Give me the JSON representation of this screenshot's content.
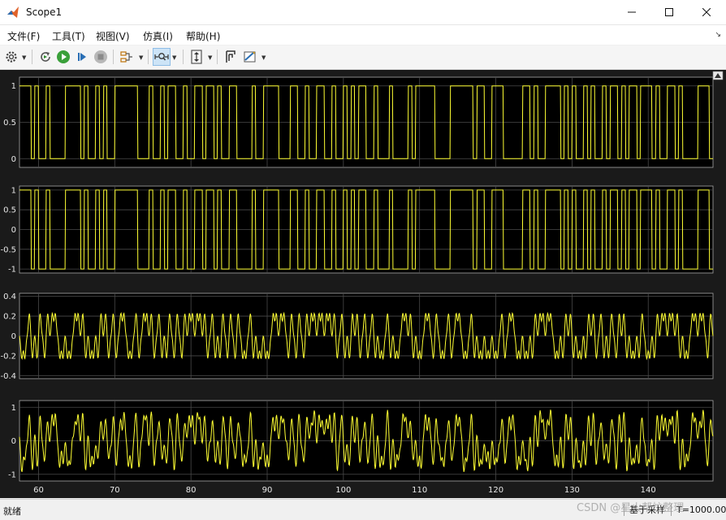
{
  "window": {
    "title": "Scope1"
  },
  "menu": [
    {
      "label": "文件(F)"
    },
    {
      "label": "工具(T)"
    },
    {
      "label": "视图(V)"
    },
    {
      "label": "仿真(I)"
    },
    {
      "label": "帮助(H)"
    }
  ],
  "toolbar": {
    "icons": [
      "gear-icon",
      "restore-icon",
      "run-icon",
      "step-forward-icon",
      "stop-icon",
      "signal-select-icon",
      "zoom-axes-icon",
      "scale-y-icon",
      "cursor-icon",
      "style-icon"
    ]
  },
  "plots": [
    {
      "yticks": [
        "1",
        "0.5",
        "0"
      ],
      "ylim": [
        -0.12,
        1.12
      ]
    },
    {
      "yticks": [
        "1",
        "0.5",
        "0",
        "-0.5",
        "-1"
      ],
      "ylim": [
        -1.1,
        1.1
      ]
    },
    {
      "yticks": [
        "0.4",
        "0.2",
        "0",
        "-0.2",
        "-0.4"
      ],
      "ylim": [
        -0.43,
        0.43
      ]
    },
    {
      "yticks": [
        "1",
        "0",
        "-1"
      ],
      "ylim": [
        -1.2,
        1.2
      ]
    }
  ],
  "xaxis": {
    "ticks": [
      "60",
      "70",
      "80",
      "90",
      "100",
      "110",
      "120",
      "130",
      "140"
    ],
    "xlim": [
      57.5,
      148.5
    ]
  },
  "colors": {
    "trace": "#ffff33",
    "axes_bg": "#000000",
    "grid": "#4a4a4a",
    "figure_bg": "#1a1a1a",
    "tick_text": "#e8e8e8"
  },
  "status": {
    "left": "就绪",
    "mode": "基于采样",
    "time": "T=1000.000"
  },
  "watermark": "CSDN @星火帮忙整理"
}
